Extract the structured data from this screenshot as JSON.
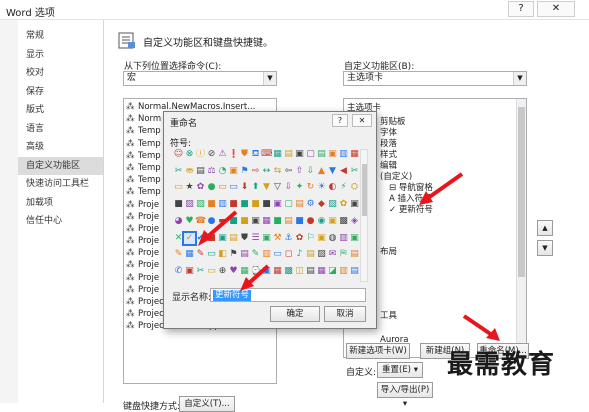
{
  "window": {
    "title": "Word 选项",
    "help": "?",
    "close": "✕"
  },
  "nav": {
    "items": [
      "常规",
      "显示",
      "校对",
      "保存",
      "版式",
      "语言",
      "高级",
      "自定义功能区",
      "快速访问工具栏",
      "加载项",
      "信任中心"
    ],
    "active_index": 7
  },
  "main": {
    "header": "自定义功能区和键盘快捷键。",
    "choose_from_label": "从下列位置选择命令(C):",
    "choose_from_value": "宏",
    "customize_ribbon_label": "自定义功能区(B):",
    "customize_ribbon_value": "主选项卡",
    "commands": [
      "Normal.NewMacros.Insert...",
      "Norm",
      "Temp",
      "Temp",
      "Temp",
      "Temp",
      "Temp",
      "Temp",
      "Proje",
      "Proje",
      "Proje",
      "Proje",
      "Proje",
      "Proje",
      "Proje",
      "Proje",
      "Project.AuroraSupport.Ma...",
      "Project.AuroraSupport.Edi...",
      "Project.AuroraSupport.Edi..."
    ],
    "tree": {
      "header": "主选项卡",
      "items": [
        "剪贴板",
        "字体",
        "段落",
        "样式",
        "编辑",
        "(自定义)"
      ],
      "custom_items": [
        "导航窗格",
        "插入符号",
        "更新符号"
      ],
      "extra": [
        "布局",
        "工具",
        "Aurora"
      ]
    },
    "new_tab_button": "新建选项卡(W)",
    "new_group_button": "新建组(N)",
    "rename_button": "重命名(M)...",
    "customize_label": "自定义:",
    "reset_button": "重置(E)",
    "import_export_button": "导入/导出(P)",
    "keyboard_label": "键盘快捷方式:",
    "keyboard_button": "自定义(T)..."
  },
  "dialog": {
    "title": "重命名",
    "help": "?",
    "close": "✕",
    "symbol_label": "符号:",
    "display_name_label": "显示名称:",
    "display_name_value": "更新符号",
    "ok_button": "确定",
    "cancel_button": "取消",
    "symbols": [
      "☺",
      "⊗",
      "ⓘ",
      "⊘",
      "⚠",
      "❗",
      "⛊",
      "⛾",
      "⌨",
      "▦",
      "▤",
      "▣",
      "▢",
      "▤",
      "▣",
      "▥",
      "▦",
      "✂",
      "⛂",
      "▤",
      "⚖",
      "◔",
      "▣",
      "⚑",
      "⇨",
      "↔",
      "⇆",
      "⇦",
      "⇧",
      "⇩",
      "▲",
      "▼",
      "◀",
      "✂",
      "▭",
      "★",
      "✿",
      "●",
      "▭",
      "▭",
      "⬇",
      "⬆",
      "▼",
      "▽",
      "⇩",
      "✦",
      "↻",
      "☀",
      "◐",
      "⚡",
      "⛭",
      "■",
      "▨",
      "▧",
      "■",
      "▥",
      "■",
      "■",
      "■",
      "■",
      "▣",
      "▢",
      "▤",
      "⚙",
      "◆",
      "▨",
      "✿",
      "▣",
      "◕",
      "♥",
      "☎",
      "●",
      "▬",
      "■",
      "■",
      "▣",
      "▦",
      "■",
      "▤",
      "■",
      "●",
      "◉",
      "▣",
      "▩",
      "◈",
      "✕",
      "✓",
      "✔",
      "■",
      "▣",
      "▤",
      "⛊",
      "☰",
      "▣",
      "⚒",
      "⚓",
      "✿",
      "⚐",
      "▣",
      "◍",
      "▥",
      "▣",
      "✎",
      "▦",
      "✎",
      "▭",
      "◧",
      "⚑",
      "▤",
      "✎",
      "▥",
      "▭",
      "◻",
      "♪",
      "▤",
      "▨",
      "✉",
      "⛿",
      "▤",
      "✆",
      "▣",
      "✂",
      "▭",
      "⊕",
      "♥",
      "▦",
      "⌚",
      "▣",
      "▦",
      "▩",
      "◫",
      "▤",
      "▦",
      "◪",
      "▥",
      "▤"
    ]
  },
  "watermark": "最需教育",
  "colors": {
    "selected_nav": "#dcdcdc",
    "arrow_red": "#e8161c",
    "selection_blue": "#3399ff"
  }
}
